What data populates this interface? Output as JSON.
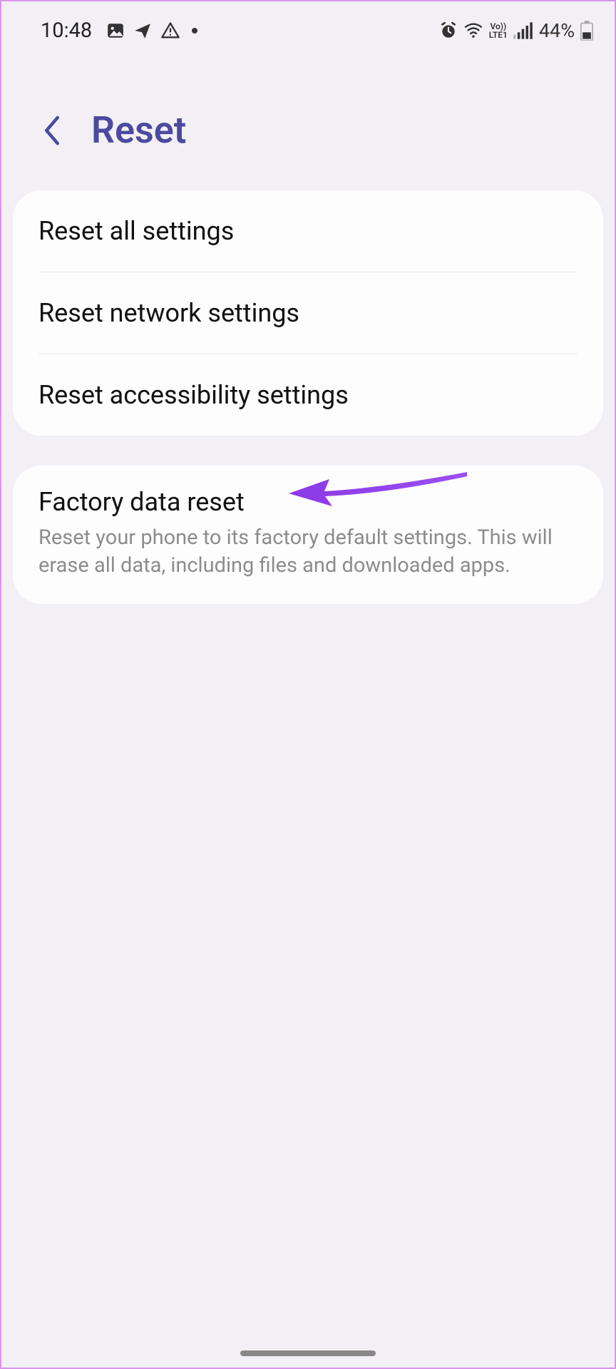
{
  "status_bar": {
    "time": "10:48",
    "battery_percent": "44%"
  },
  "header": {
    "title": "Reset"
  },
  "group1": {
    "items": [
      {
        "title": "Reset all settings"
      },
      {
        "title": "Reset network settings"
      },
      {
        "title": "Reset accessibility settings"
      }
    ]
  },
  "group2": {
    "items": [
      {
        "title": "Factory data reset",
        "desc": "Reset your phone to its factory default settings. This will erase all data, including files and downloaded apps."
      }
    ]
  }
}
